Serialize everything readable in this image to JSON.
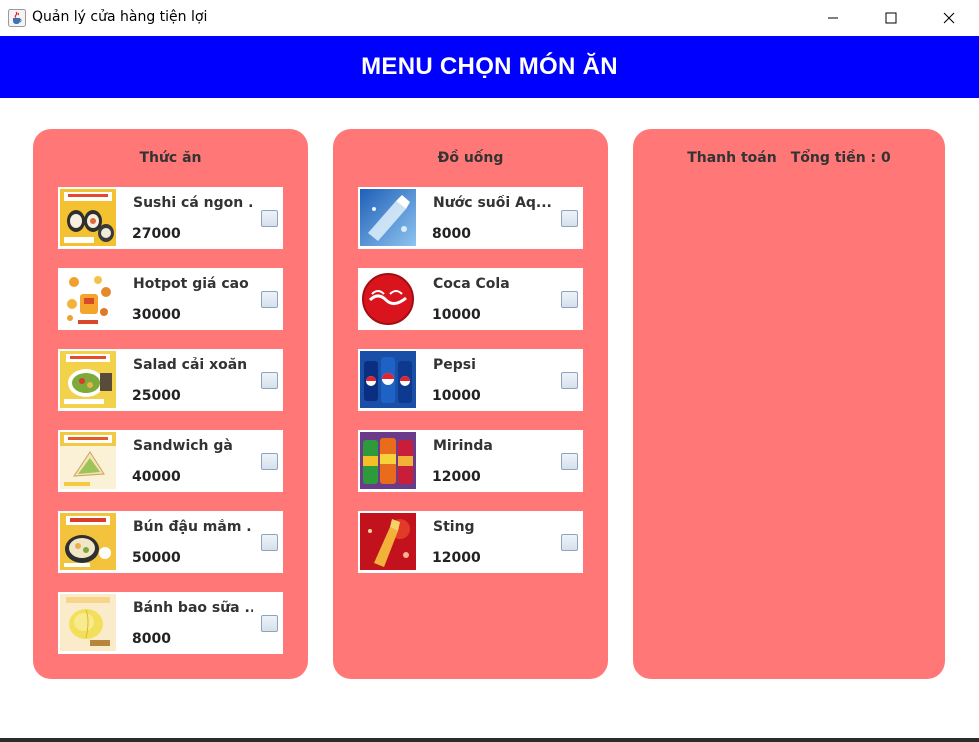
{
  "window": {
    "title": "Quản lý cửa hàng tiện lợi",
    "icons": {
      "app": "java-cup-icon",
      "minimize": "minimize-icon",
      "maximize": "maximize-icon",
      "close": "close-icon"
    }
  },
  "header": {
    "title": "MENU CHỌN MÓN ĂN",
    "background": "#0000ff"
  },
  "colors": {
    "panel": "#ff7777",
    "accent": "#0000ff"
  },
  "food_panel": {
    "title": "Thức ăn",
    "items": [
      {
        "name": "Sushi cá ngon ..",
        "price": "27000",
        "checked": false
      },
      {
        "name": "Hotpot giá cao",
        "price": "30000",
        "checked": false
      },
      {
        "name": "Salad cải xoăn",
        "price": "25000",
        "checked": false
      },
      {
        "name": "Sandwich gà",
        "price": "40000",
        "checked": false
      },
      {
        "name": "Bún đậu mắm ...",
        "price": "50000",
        "checked": false
      },
      {
        "name": "Bánh bao sữa ...",
        "price": "8000",
        "checked": false
      }
    ]
  },
  "drink_panel": {
    "title": "Đồ uống",
    "items": [
      {
        "name": "Nước suối Aq...",
        "price": "8000",
        "checked": false
      },
      {
        "name": "Coca Cola",
        "price": "10000",
        "checked": false
      },
      {
        "name": "Pepsi",
        "price": "10000",
        "checked": false
      },
      {
        "name": "Mirinda",
        "price": "12000",
        "checked": false
      },
      {
        "name": "Sting",
        "price": "12000",
        "checked": false
      }
    ]
  },
  "payment_panel": {
    "title": "Thanh toán",
    "total_label": "Tổng tiền : 0"
  }
}
